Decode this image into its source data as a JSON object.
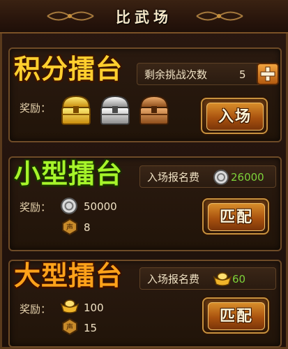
{
  "header": {
    "title": "比武场"
  },
  "arenas": [
    {
      "title": "积分擂台",
      "info_label": "剩余挑战次数",
      "info_value": "5",
      "reward_label": "奖励：",
      "button_label": "入场"
    },
    {
      "title": "小型擂台",
      "info_label": "入场报名费",
      "info_value": "26000",
      "reward_label": "奖励：",
      "reward_silver": "50000",
      "reward_fame": "8",
      "button_label": "匹配"
    },
    {
      "title": "大型擂台",
      "info_label": "入场报名费",
      "info_value": "60",
      "reward_label": "奖励：",
      "reward_gold": "100",
      "reward_fame": "15",
      "button_label": "匹配"
    }
  ],
  "colors": {
    "gold": "#ffcf2e",
    "green_value": "#7dd23a",
    "panel_border": "#6e4b27"
  }
}
